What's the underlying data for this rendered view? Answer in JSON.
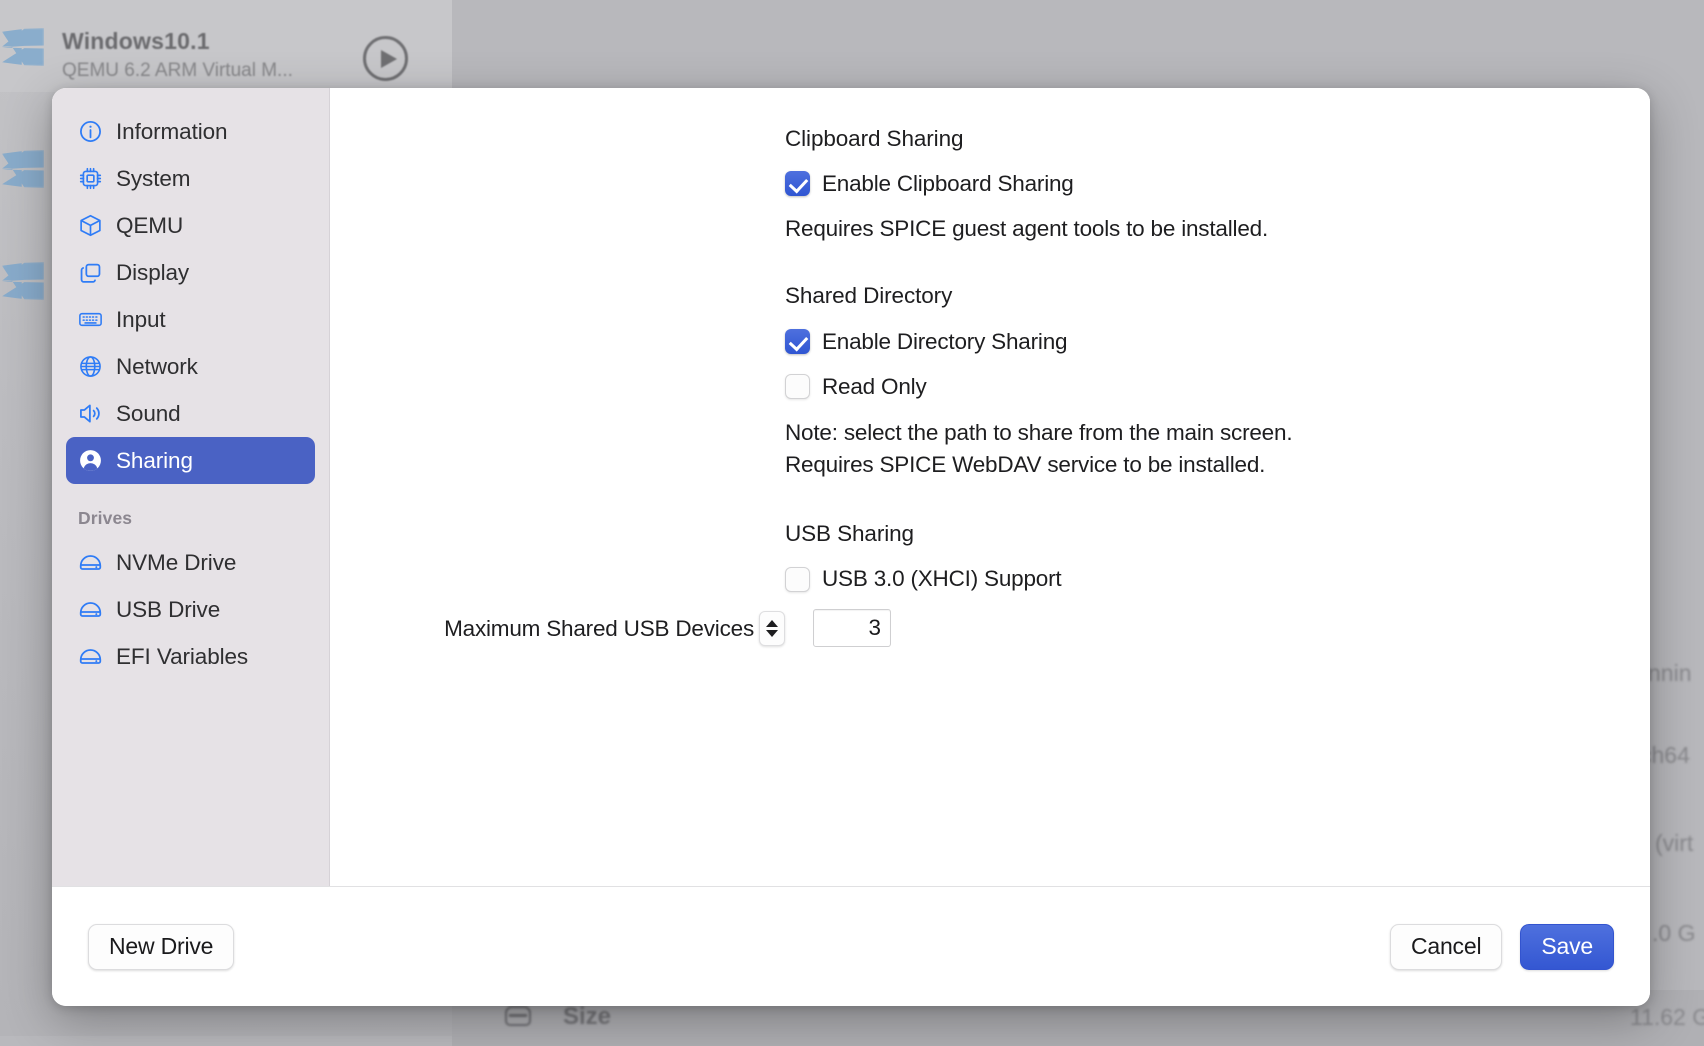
{
  "background": {
    "window_title": "Windows10.1",
    "window_subtitle": "QEMU 6.2 ARM Virtual M...",
    "play_icon": "play-icon",
    "logo_icon": "windows-logo-icon",
    "fragments": {
      "status": "nnin",
      "arch": "ch64",
      "virt": "(virt",
      "size_label": "Size",
      "size_value": "11.62 G",
      "mem_value": ".0 G",
      "drive_icon": "drive-icon"
    }
  },
  "sidebar": {
    "items": [
      {
        "label": "Information",
        "icon": "info-circle-icon",
        "selected": false
      },
      {
        "label": "System",
        "icon": "cpu-chip-icon",
        "selected": false
      },
      {
        "label": "QEMU",
        "icon": "cube-box-icon",
        "selected": false
      },
      {
        "label": "Display",
        "icon": "windows-stack-icon",
        "selected": false
      },
      {
        "label": "Input",
        "icon": "keyboard-icon",
        "selected": false
      },
      {
        "label": "Network",
        "icon": "globe-icon",
        "selected": false
      },
      {
        "label": "Sound",
        "icon": "speaker-wave-icon",
        "selected": false
      },
      {
        "label": "Sharing",
        "icon": "person-circle-icon",
        "selected": true
      }
    ],
    "group_title": "Drives",
    "drives": [
      {
        "label": "NVMe Drive",
        "icon": "drive-icon"
      },
      {
        "label": "USB Drive",
        "icon": "drive-icon"
      },
      {
        "label": "EFI Variables",
        "icon": "drive-icon"
      }
    ]
  },
  "content": {
    "clipboard": {
      "section_title": "Clipboard Sharing",
      "enable_label": "Enable Clipboard Sharing",
      "enable_checked": true,
      "note": "Requires SPICE guest agent tools to be installed."
    },
    "shared_directory": {
      "section_title": "Shared Directory",
      "enable_label": "Enable Directory Sharing",
      "enable_checked": true,
      "readonly_label": "Read Only",
      "readonly_checked": false,
      "note_line1": "Note: select the path to share from the main screen.",
      "note_line2": "Requires SPICE WebDAV service to be installed."
    },
    "usb": {
      "section_title": "USB Sharing",
      "xhci_label": "USB 3.0 (XHCI) Support",
      "xhci_checked": false,
      "max_devices_label": "Maximum Shared USB Devices",
      "max_devices_value": "3",
      "stepper_icon": "stepper-up-down-icon"
    }
  },
  "footer": {
    "new_drive_label": "New Drive",
    "cancel_label": "Cancel",
    "save_label": "Save"
  },
  "colors": {
    "accent_blue": "#2f7cf6",
    "selected_blue": "#4a62c4",
    "checkbox_blue": "#3f63d8",
    "sidebar_bg": "#e6e2e6"
  }
}
